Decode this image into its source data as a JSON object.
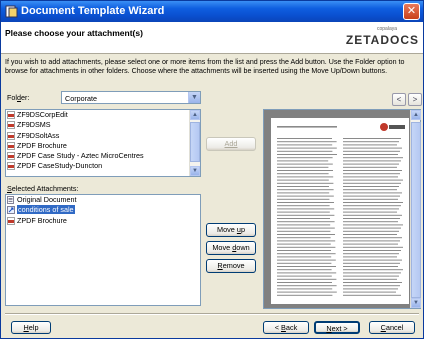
{
  "window": {
    "title": "Document Template Wizard",
    "close_label": "✕"
  },
  "header": {
    "heading": "Please choose your attachment(s)",
    "logo_small": "copalaya",
    "logo_big": "ZETADOCS"
  },
  "instructions": "If you wish to add attachments, please select one or more items from the list and press the Add button. Use the Folder option to browse for attachments in other folders. Choose where the attachments will be inserted using the Move Up/Down buttons.",
  "folder": {
    "label_pre": "Fol",
    "label_u": "d",
    "label_post": "er:",
    "value": "Corporate"
  },
  "available_items": [
    {
      "label": "ZF9DSCorpEdit"
    },
    {
      "label": "ZF9DSMS"
    },
    {
      "label": "ZF9DSoltAss"
    },
    {
      "label": "ZPDF Brochure"
    },
    {
      "label": "ZPDF Case Study - Aztec MicroCentres"
    },
    {
      "label": "ZPDF CaseStudy-Duncton"
    }
  ],
  "selected": {
    "label_u": "S",
    "label_post": "elected Attachments:",
    "items": [
      {
        "label": "Original Document"
      },
      {
        "label": "conditions of sale"
      },
      {
        "label": "ZPDF Brochure"
      }
    ]
  },
  "buttons": {
    "add": "Add",
    "move_up_pre": "Move ",
    "move_up_u": "u",
    "move_up_post": "p",
    "move_down_pre": "Move ",
    "move_down_u": "d",
    "move_down_post": "own",
    "remove_u": "R",
    "remove_post": "emove",
    "help_u": "H",
    "help_post": "elp",
    "back_lt": "< ",
    "back_u": "B",
    "back_post": "ack",
    "next_u": "N",
    "next_post": "ext >",
    "cancel_u": "C",
    "cancel_post": "ancel",
    "prev_page": "<",
    "next_page": ">"
  },
  "colors": {
    "title_bar": "#0a4fd0",
    "selection": "#316ac5",
    "pdf_icon": "#c0392b"
  }
}
